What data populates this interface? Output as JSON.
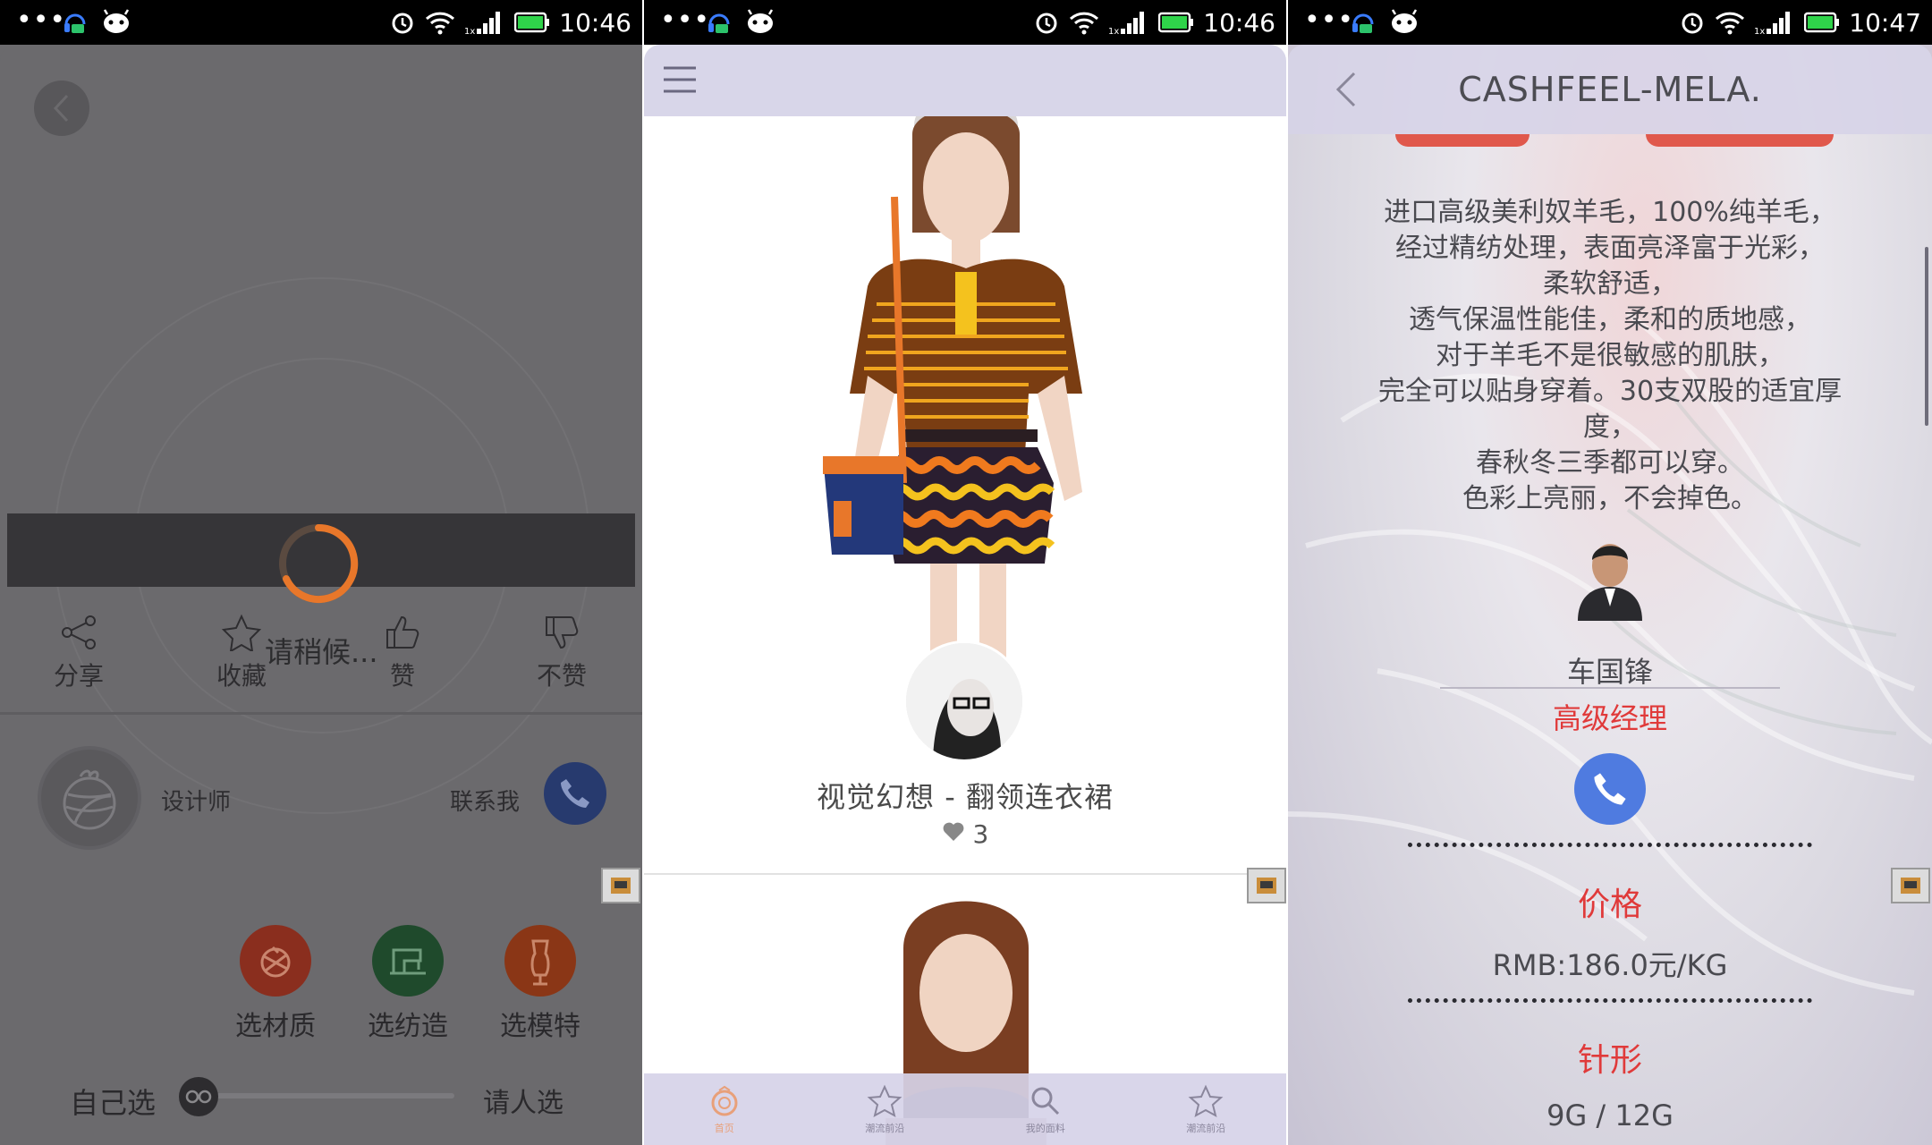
{
  "status_bars": [
    {
      "dots": "•••",
      "time": "10:46"
    },
    {
      "dots": "•••",
      "time": "10:46"
    },
    {
      "dots": "•••",
      "time": "10:47"
    }
  ],
  "screen1": {
    "loading_text": "请稍候...",
    "actions": [
      {
        "label": "分享",
        "icon": "share-icon"
      },
      {
        "label": "收藏",
        "icon": "star-icon"
      },
      {
        "label": "赞",
        "icon": "thumbs-up-icon"
      },
      {
        "label": "不赞",
        "icon": "thumbs-down-icon"
      }
    ],
    "designer_label": "设计师",
    "contact_label": "联系我",
    "options": [
      {
        "label": "选材质",
        "icon": "yarn-icon",
        "color": "#8a2e1e"
      },
      {
        "label": "选纺造",
        "icon": "sewing-machine-icon",
        "color": "#1f4a2c"
      },
      {
        "label": "选模特",
        "icon": "mannequin-icon",
        "color": "#8a3616"
      }
    ],
    "self_choose": "自己选",
    "ask_choose": "请人选",
    "slider_position": 0
  },
  "screen2": {
    "product_title": "视觉幻想 - 翻领连衣裙",
    "likes": "3",
    "nav": [
      {
        "label": "首页",
        "icon": "home-icon",
        "active": true
      },
      {
        "label": "潮流前沿",
        "icon": "star-icon",
        "active": false
      },
      {
        "label": "我的面料",
        "icon": "search-icon",
        "active": false
      },
      {
        "label": "潮流前沿",
        "icon": "star-outline-icon",
        "active": false
      }
    ]
  },
  "screen3": {
    "title": "CASHFEEL-MELA.",
    "description": [
      "进口高级美利奴羊毛，100%纯羊毛，",
      "经过精纺处理，表面亮泽富于光彩，",
      "柔软舒适，",
      "透气保温性能佳，柔和的质地感，",
      "对于羊毛不是很敏感的肌肤，",
      "完全可以贴身穿着。30支双股的适宜厚",
      "度，",
      "春秋冬三季都可以穿。",
      "色彩上亮丽，不会掉色。"
    ],
    "manager_name": "车国锋",
    "manager_title": "高级经理",
    "price_label": "价格",
    "price_value": "RMB:186.0元/KG",
    "gauge_label": "针形",
    "gauge_value": "9G / 12G"
  },
  "colors": {
    "accent_red": "#e03a3a",
    "phone_blue": "#4f7be0",
    "spinner_orange": "#e8772a"
  }
}
